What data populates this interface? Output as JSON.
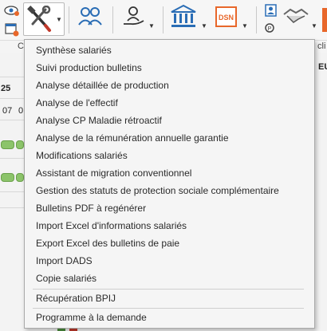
{
  "toolbar": {
    "group_label_left": "C",
    "group_label_right": "cli",
    "right_edge_text": "EU"
  },
  "sheet": {
    "day_number": "25",
    "column_labels": [
      "07",
      "0"
    ]
  },
  "menu": {
    "items": [
      "Synthèse salariés",
      "Suivi production bulletins",
      "Analyse détaillée de production",
      "Analyse de l'effectif",
      "Analyse CP Maladie rétroactif",
      "Analyse de la rémunération annuelle garantie",
      "Modifications salariés",
      "Assistant de migration conventionnel",
      "Gestion des statuts de protection sociale complémentaire",
      "Bulletins PDF à regénérer",
      "Import Excel d'informations salariés",
      "Export Excel des bulletins de paie",
      "Import DADS",
      "Copie salariés"
    ],
    "items_after_sep1": [
      "Récupération BPIJ"
    ],
    "items_after_sep2": [
      "Programme à la demande"
    ]
  },
  "colors": {
    "accent_blue": "#2a6db5",
    "orange": "#e8672a",
    "status_green": "#8cc46a"
  }
}
